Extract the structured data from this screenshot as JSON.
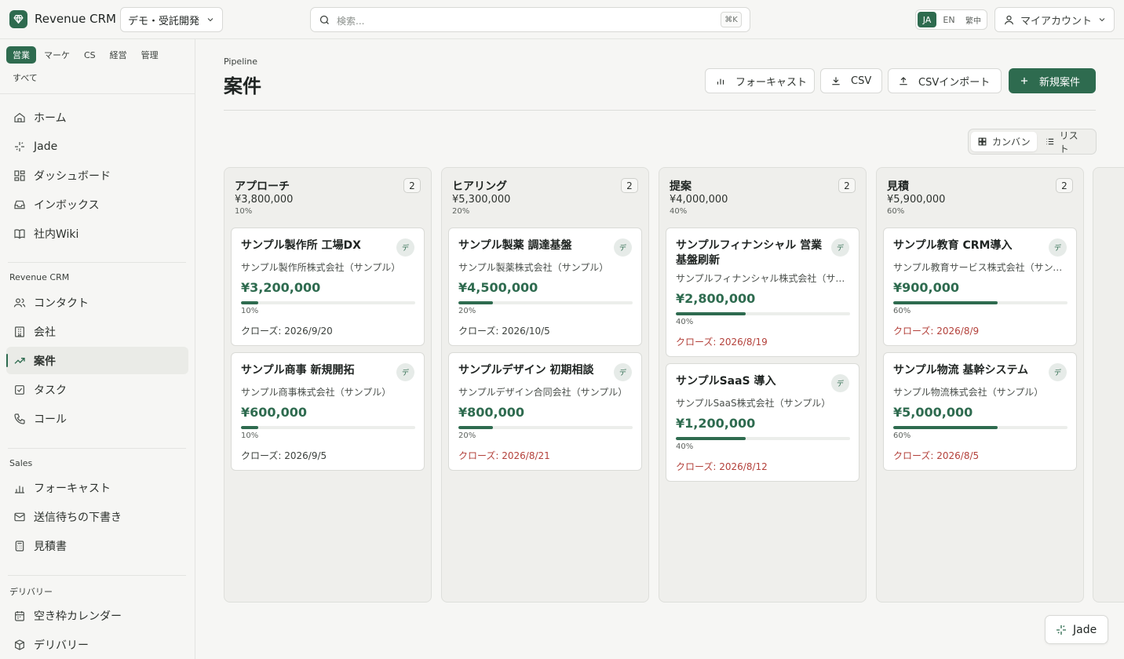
{
  "topbar": {
    "brand": "Revenue CRM",
    "tenant": "デモ・受託開発",
    "search_placeholder": "検索...",
    "search_shortcut": "⌘K",
    "languages": [
      "JA",
      "EN",
      "繁中"
    ],
    "account": "マイアカウント"
  },
  "sidebar": {
    "segments": [
      "営業",
      "マーケ",
      "CS",
      "経営",
      "管理"
    ],
    "segment_all": "すべて",
    "main_nav": [
      {
        "label": "ホーム",
        "icon": "home-icon"
      },
      {
        "label": "Jade",
        "icon": "sparkle-icon"
      },
      {
        "label": "ダッシュボード",
        "icon": "dashboard-icon"
      },
      {
        "label": "インボックス",
        "icon": "inbox-icon"
      },
      {
        "label": "社内Wiki",
        "icon": "book-icon"
      }
    ],
    "crm_label": "Revenue CRM",
    "crm_nav": [
      {
        "label": "コンタクト",
        "icon": "users-icon"
      },
      {
        "label": "会社",
        "icon": "building-icon"
      },
      {
        "label": "案件",
        "icon": "trending-icon"
      },
      {
        "label": "タスク",
        "icon": "task-icon"
      },
      {
        "label": "コール",
        "icon": "phone-icon"
      }
    ],
    "sales_label": "Sales",
    "sales_nav": [
      {
        "label": "フォーキャスト",
        "icon": "bar-chart-icon"
      },
      {
        "label": "送信待ちの下書き",
        "icon": "mail-icon"
      },
      {
        "label": "見積書",
        "icon": "calculator-icon"
      }
    ],
    "delivery_label": "デリバリー",
    "delivery_nav": [
      {
        "label": "空き枠カレンダー",
        "icon": "calendar-icon"
      },
      {
        "label": "デリバリー",
        "icon": "package-icon"
      }
    ]
  },
  "main": {
    "eyebrow": "Pipeline",
    "title": "案件",
    "actions": {
      "forecast": "フォーキャスト",
      "csv": "CSV",
      "csv_import": "CSVインポート",
      "new_deal": "新規案件"
    },
    "view_toggle": {
      "kanban": "カンバン",
      "list": "リスト"
    }
  },
  "columns": [
    {
      "name": "アプローチ",
      "amount": "¥3,800,000",
      "pct": "10%",
      "count": "2",
      "cards": [
        {
          "title": "サンプル製作所 工場DX",
          "badge": "デ",
          "company": "サンプル製作所株式会社（サンプル）",
          "amount": "¥3,200,000",
          "progress": 10,
          "pct": "10%",
          "close": "クローズ: 2026/9/20",
          "overdue": false
        },
        {
          "title": "サンプル商事 新規開拓",
          "badge": "デ",
          "company": "サンプル商事株式会社（サンプル）",
          "amount": "¥600,000",
          "progress": 10,
          "pct": "10%",
          "close": "クローズ: 2026/9/5",
          "overdue": false
        }
      ]
    },
    {
      "name": "ヒアリング",
      "amount": "¥5,300,000",
      "pct": "20%",
      "count": "2",
      "cards": [
        {
          "title": "サンプル製薬 調達基盤",
          "badge": "デ",
          "company": "サンプル製薬株式会社（サンプル）",
          "amount": "¥4,500,000",
          "progress": 20,
          "pct": "20%",
          "close": "クローズ: 2026/10/5",
          "overdue": false
        },
        {
          "title": "サンプルデザイン 初期相談",
          "badge": "デ",
          "company": "サンプルデザイン合同会社（サンプル）",
          "amount": "¥800,000",
          "progress": 20,
          "pct": "20%",
          "close": "クローズ: 2026/8/21",
          "overdue": true
        }
      ]
    },
    {
      "name": "提案",
      "amount": "¥4,000,000",
      "pct": "40%",
      "count": "2",
      "cards": [
        {
          "title": "サンプルフィナンシャル 営業基盤刷新",
          "badge": "デ",
          "company": "サンプルフィナンシャル株式会社（サン…",
          "amount": "¥2,800,000",
          "progress": 40,
          "pct": "40%",
          "close": "クローズ: 2026/8/19",
          "overdue": true
        },
        {
          "title": "サンプルSaaS 導入",
          "badge": "デ",
          "company": "サンプルSaaS株式会社（サンプル）",
          "amount": "¥1,200,000",
          "progress": 40,
          "pct": "40%",
          "close": "クローズ: 2026/8/12",
          "overdue": true
        }
      ]
    },
    {
      "name": "見積",
      "amount": "¥5,900,000",
      "pct": "60%",
      "count": "2",
      "cards": [
        {
          "title": "サンプル教育 CRM導入",
          "badge": "デ",
          "company": "サンプル教育サービス株式会社（サンプ…",
          "amount": "¥900,000",
          "progress": 60,
          "pct": "60%",
          "close": "クローズ: 2026/8/9",
          "overdue": true
        },
        {
          "title": "サンプル物流 基幹システム",
          "badge": "デ",
          "company": "サンプル物流株式会社（サンプル）",
          "amount": "¥5,000,000",
          "progress": 60,
          "pct": "60%",
          "close": "クローズ: 2026/8/5",
          "overdue": true
        }
      ]
    }
  ],
  "fab": {
    "label": "Jade"
  },
  "colors": {
    "accent": "#2e6b4f",
    "overdue": "#b3403a"
  }
}
